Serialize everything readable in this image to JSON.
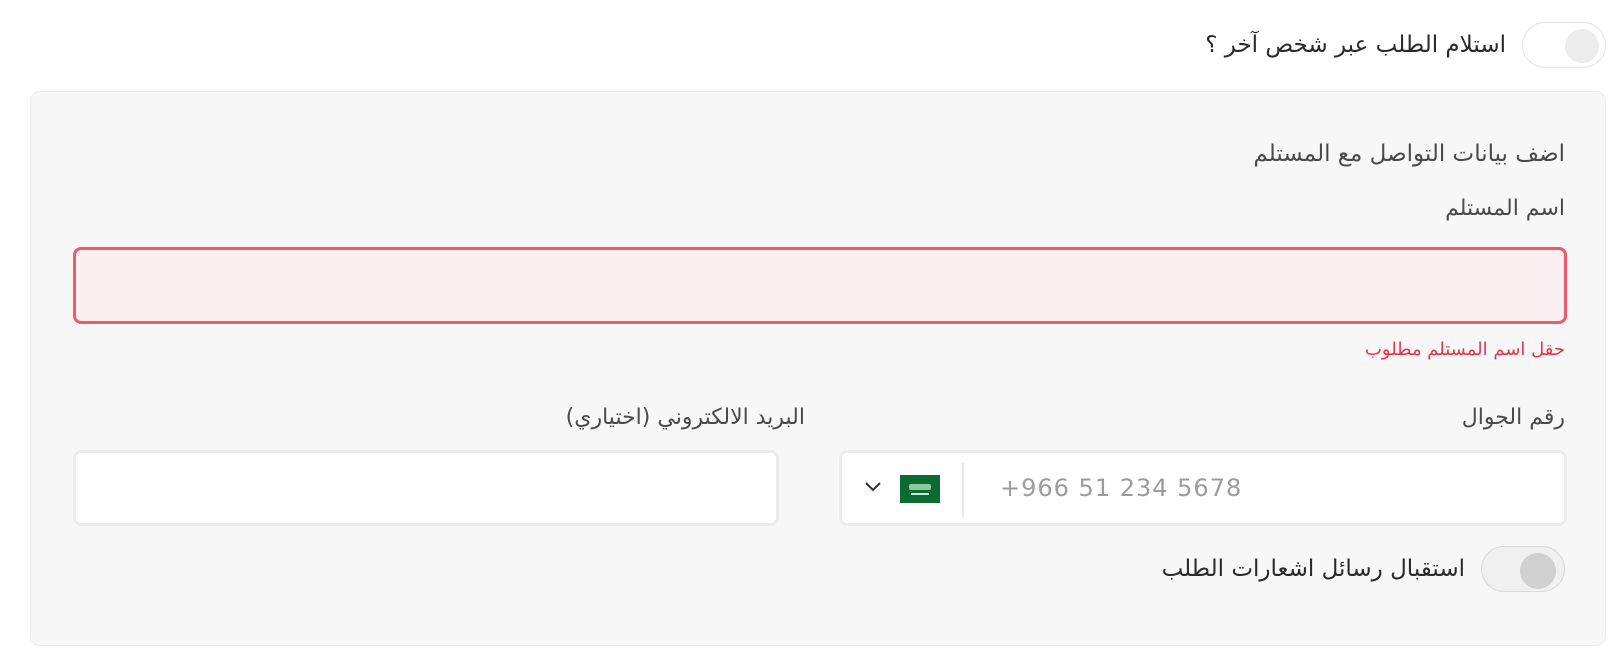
{
  "top": {
    "toggle_label": "استلام الطلب عبر شخص آخر ؟",
    "toggle_on": false
  },
  "panel": {
    "section_title": "اضف بيانات التواصل مع المستلم",
    "recipient_name": {
      "label": "اسم المستلم",
      "value": "",
      "error": "حقل اسم المستلم مطلوب"
    },
    "phone": {
      "label": "رقم الجوال",
      "placeholder": "+966 51 234 5678",
      "country_flag": "saudi-arabia-flag"
    },
    "email": {
      "label": "البريد الالكتروني (اختياري)",
      "value": ""
    },
    "notifications": {
      "label": "استقبال رسائل اشعارات الطلب",
      "toggle_on": false
    }
  },
  "colors": {
    "error_border": "#ee5a6c",
    "error_bg": "#fbeff1",
    "error_text": "#e2384e",
    "panel_bg": "#f7f7f7",
    "flag_green": "#0a6b33"
  }
}
